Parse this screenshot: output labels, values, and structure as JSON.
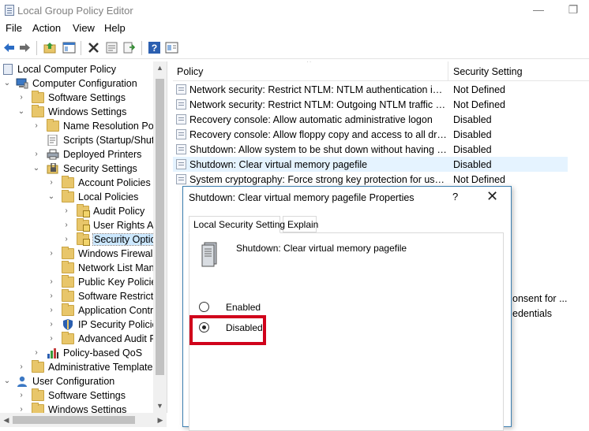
{
  "window": {
    "title": "Local Group Policy Editor"
  },
  "menu": [
    "File",
    "Action",
    "View",
    "Help"
  ],
  "toolbar": {
    "icons": [
      "back-arrow-icon",
      "forward-arrow-icon",
      "up-folder-icon",
      "show-hide-tree-icon",
      "delete-icon",
      "properties-icon",
      "export-list-icon",
      "help-icon",
      "view-icon"
    ]
  },
  "tree": {
    "items": [
      {
        "label": "Local Computer Policy",
        "icon": "policy-icon"
      },
      {
        "label": "Computer Configuration",
        "icon": "computer-icon"
      },
      {
        "label": "Software Settings",
        "icon": "folder-icon"
      },
      {
        "label": "Windows Settings",
        "icon": "folder-icon"
      },
      {
        "label": "Name Resolution Poli",
        "icon": "folder-icon"
      },
      {
        "label": "Scripts (Startup/Shutd",
        "icon": "script-icon"
      },
      {
        "label": "Deployed Printers",
        "icon": "printer-icon"
      },
      {
        "label": "Security Settings",
        "icon": "security-icon"
      },
      {
        "label": "Account Policies",
        "icon": "folder-icon"
      },
      {
        "label": "Local Policies",
        "icon": "folder-icon"
      },
      {
        "label": "Audit Policy",
        "icon": "locked-folder-icon"
      },
      {
        "label": "User Rights As",
        "icon": "locked-folder-icon"
      },
      {
        "label": "Security Optio",
        "icon": "locked-folder-icon"
      },
      {
        "label": "Windows Firewall",
        "icon": "folder-icon"
      },
      {
        "label": "Network List Mana",
        "icon": "folder-icon"
      },
      {
        "label": "Public Key Policies",
        "icon": "folder-icon"
      },
      {
        "label": "Software Restrictio",
        "icon": "folder-icon"
      },
      {
        "label": "Application Contr",
        "icon": "folder-icon"
      },
      {
        "label": "IP Security Policies",
        "icon": "shield-icon"
      },
      {
        "label": "Advanced Audit P",
        "icon": "folder-icon"
      },
      {
        "label": "Policy-based QoS",
        "icon": "chart-icon"
      },
      {
        "label": "Administrative Templates",
        "icon": "folder-icon"
      },
      {
        "label": "User Configuration",
        "icon": "user-icon"
      },
      {
        "label": "Software Settings",
        "icon": "folder-icon"
      },
      {
        "label": "Windows Settings",
        "icon": "folder-icon"
      }
    ]
  },
  "list": {
    "headers": {
      "policy": "Policy",
      "setting": "Security Setting"
    },
    "rows": [
      {
        "policy": "Network security: Restrict NTLM: NTLM authentication in th...",
        "setting": "Not Defined"
      },
      {
        "policy": "Network security: Restrict NTLM: Outgoing NTLM traffic to ...",
        "setting": "Not Defined"
      },
      {
        "policy": "Recovery console: Allow automatic administrative logon",
        "setting": "Disabled"
      },
      {
        "policy": "Recovery console: Allow floppy copy and access to all drives...",
        "setting": "Disabled"
      },
      {
        "policy": "Shutdown: Allow system to be shut down without having to...",
        "setting": "Disabled"
      },
      {
        "policy": "Shutdown: Clear virtual memory pagefile",
        "setting": "Disabled"
      },
      {
        "policy": "System cryptography: Force strong key protection for user k...",
        "setting": "Not Defined"
      }
    ],
    "partial": {
      "line1": "onsent for ...",
      "line2": "edentials"
    }
  },
  "dialog": {
    "title": "Shutdown: Clear virtual memory pagefile Properties",
    "help": "?",
    "close": "✕",
    "tabs": [
      "Local Security Setting",
      "Explain"
    ],
    "policy_name": "Shutdown: Clear virtual memory pagefile",
    "options": [
      {
        "label": "Enabled",
        "checked": false
      },
      {
        "label": "Disabled",
        "checked": true
      }
    ]
  },
  "colors": {
    "highlight_box": "#d0021b",
    "selected_row": "#e5f3ff",
    "dialog_border": "#3c7fb1"
  }
}
